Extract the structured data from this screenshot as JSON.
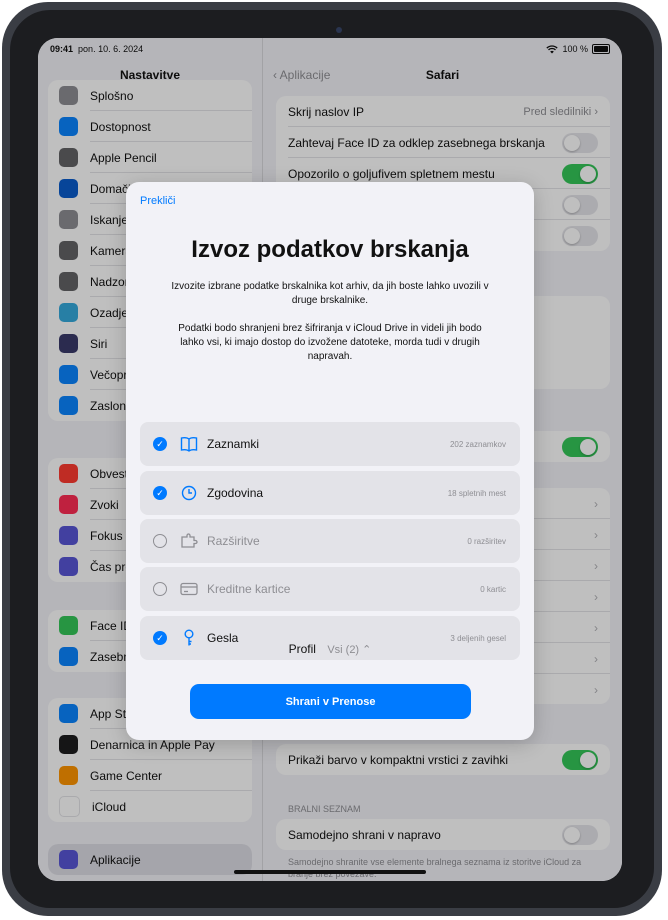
{
  "status": {
    "time": "09:41",
    "date": "pon. 10. 6. 2024",
    "battery": "100 %"
  },
  "sidebar": {
    "title": "Nastavitve",
    "groups": [
      [
        {
          "label": "Splošno",
          "color": "#8e8e93",
          "icon": "gear-icon"
        },
        {
          "label": "Dostopnost",
          "color": "#0a84ff",
          "icon": "accessibility-icon"
        },
        {
          "label": "Apple Pencil",
          "color": "#636366",
          "icon": "pencil-icon"
        },
        {
          "label": "Domači zaslon in knjižnica",
          "color": "#0a5ccc",
          "icon": "home-screen-icon"
        },
        {
          "label": "Iskanje",
          "color": "#8e8e93",
          "icon": "search-icon"
        },
        {
          "label": "Kamera",
          "color": "#636366",
          "icon": "camera-icon"
        },
        {
          "label": "Nadzorni center",
          "color": "#636366",
          "icon": "control-center-icon"
        },
        {
          "label": "Ozadje",
          "color": "#34aadc",
          "icon": "wallpaper-icon"
        },
        {
          "label": "Siri",
          "color": "#3a3a6a",
          "icon": "siri-icon"
        },
        {
          "label": "Večopravilnost",
          "color": "#0a84ff",
          "icon": "multitasking-icon"
        },
        {
          "label": "Zaslon in svetlost",
          "color": "#0a84ff",
          "icon": "brightness-icon"
        }
      ],
      [
        {
          "label": "Obvestila",
          "color": "#ff3b30",
          "icon": "bell-icon"
        },
        {
          "label": "Zvoki",
          "color": "#ff2d55",
          "icon": "speaker-icon"
        },
        {
          "label": "Fokus",
          "color": "#5856d6",
          "icon": "moon-icon"
        },
        {
          "label": "Čas pred zaslonom",
          "color": "#5856d6",
          "icon": "hourglass-icon"
        }
      ],
      [
        {
          "label": "Face ID in koda",
          "color": "#34c759",
          "icon": "face-id-icon"
        },
        {
          "label": "Zasebnost in varnost",
          "color": "#0a84ff",
          "icon": "hand-icon"
        }
      ],
      [
        {
          "label": "App Store",
          "color": "#0a84ff",
          "icon": "app-store-icon"
        },
        {
          "label": "Denarnica in Apple Pay",
          "color": "#1c1c1e",
          "icon": "wallet-icon"
        },
        {
          "label": "Game Center",
          "color": "#ff9500",
          "icon": "game-center-icon"
        },
        {
          "label": "iCloud",
          "color": "#ffffff",
          "icon": "icloud-icon"
        }
      ]
    ],
    "apps_item": {
      "label": "Aplikacije",
      "color": "#5856d6",
      "icon": "apps-icon"
    }
  },
  "detail": {
    "back_label": "Aplikacije",
    "title": "Safari",
    "rows_top": [
      {
        "label": "Skrij naslov IP",
        "value": "Pred sledilniki",
        "type": "chevron"
      },
      {
        "label": "Zahtevaj Face ID za odklep zasebnega brskanja",
        "type": "toggle",
        "on": false
      },
      {
        "label": "Opozorilo o goljufivem spletnem mestu",
        "type": "toggle",
        "on": true
      },
      {
        "label": "",
        "type": "toggle",
        "on": false
      },
      {
        "label": "",
        "type": "toggle",
        "on": false
      }
    ],
    "compact_row": {
      "label": "Prikaži barvo v kompaktni vrstici z zavihki",
      "on": true
    },
    "reading_list_header": "BRALNI SEZNAM",
    "reading_row": {
      "label": "Samodejno shrani v napravo",
      "on": false
    },
    "reading_footer": "Samodejno shranite vse elemente bralnega seznama iz storitve iCloud za branje brez povezave."
  },
  "modal": {
    "cancel_label": "Prekliči",
    "title": "Izvoz podatkov brskanja",
    "description_1": "Izvozite izbrane podatke brskalnika kot arhiv, da jih boste lahko uvozili v druge brskalnike.",
    "description_2": "Podatki bodo shranjeni brez šifriranja v iCloud Drive in videli jih bodo lahko vsi, ki imajo dostop do izvožene datoteke, morda tudi v drugih napravah.",
    "options": [
      {
        "label": "Zaznamki",
        "count": "202 zaznamkov",
        "checked": true,
        "icon": "book-icon"
      },
      {
        "label": "Zgodovina",
        "count": "18 spletnih mest",
        "checked": true,
        "icon": "clock-icon"
      },
      {
        "label": "Razširitve",
        "count": "0 razširitev",
        "checked": false,
        "icon": "extension-icon"
      },
      {
        "label": "Kreditne kartice",
        "count": "0 kartic",
        "checked": false,
        "icon": "credit-card-icon"
      },
      {
        "label": "Gesla",
        "count": "3 deljenih gesel",
        "checked": true,
        "icon": "key-icon"
      }
    ],
    "profile_label": "Profil",
    "profile_value": "Vsi (2)",
    "save_label": "Shrani v Prenose"
  },
  "colors": {
    "accent": "#007aff",
    "toggle_on": "#34c759"
  }
}
